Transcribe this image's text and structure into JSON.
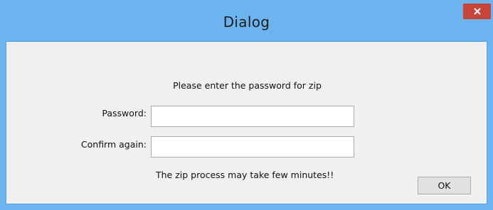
{
  "window": {
    "title": "Dialog",
    "close_icon": "close-icon",
    "colors": {
      "title_bar": "#6bb4ef",
      "close_button": "#c7443a",
      "client_background": "#f0f0f0"
    }
  },
  "form": {
    "prompt": "Please enter the password for zip",
    "password_label": "Password:",
    "password_value": "",
    "confirm_label": "Confirm again:",
    "confirm_value": "",
    "note": "The zip process may take few minutes!!"
  },
  "buttons": {
    "ok_label": "OK"
  }
}
